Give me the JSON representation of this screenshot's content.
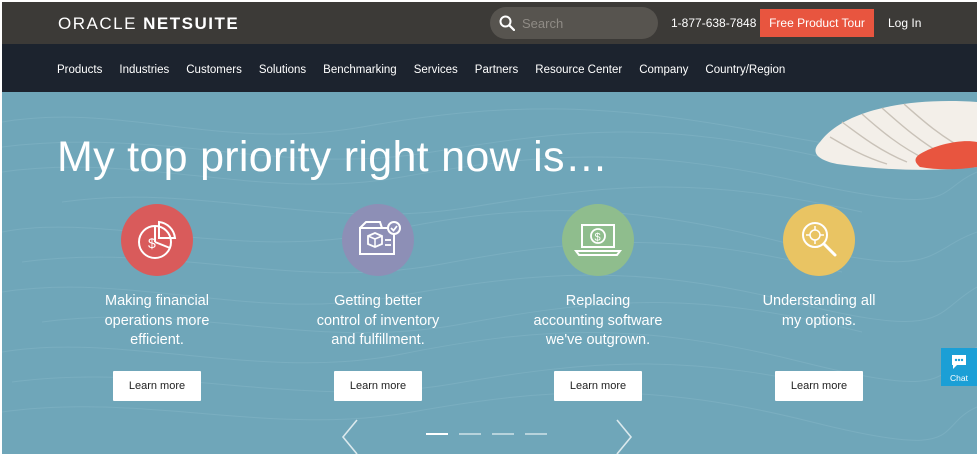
{
  "header": {
    "logo_left": "ORACLE",
    "logo_right": "NETSUITE",
    "search_placeholder": "Search",
    "phone": "1-877-638-7848",
    "tour_button": "Free Product Tour",
    "login": "Log In"
  },
  "nav": {
    "items": [
      "Products",
      "Industries",
      "Customers",
      "Solutions",
      "Benchmarking",
      "Services",
      "Partners",
      "Resource Center",
      "Company",
      "Country/Region"
    ]
  },
  "hero": {
    "headline": "My top priority right now is…",
    "cards": [
      {
        "lines": [
          "Making financial",
          "operations more",
          "efficient."
        ],
        "button": "Learn more",
        "icon": "financial-chart-icon",
        "color": "#d95b5b"
      },
      {
        "lines": [
          "Getting better",
          "control of inventory",
          "and fulfillment."
        ],
        "button": "Learn more",
        "icon": "inventory-box-icon",
        "color": "#8d8fb6"
      },
      {
        "lines": [
          "Replacing",
          "accounting software",
          "we've outgrown."
        ],
        "button": "Learn more",
        "icon": "laptop-dollar-icon",
        "color": "#8fbd8d"
      },
      {
        "lines": [
          "Understanding all",
          "my options."
        ],
        "button": "Learn more",
        "icon": "magnifier-target-icon",
        "color": "#e9c463"
      }
    ],
    "slides": 4,
    "active_slide": 1
  },
  "chat": {
    "label": "Chat"
  },
  "colors": {
    "topbar": "#3c3a37",
    "navbar": "#1c232e",
    "hero": "#6fa6b9",
    "accent": "#e8553f",
    "chat": "#1b9fd6"
  }
}
